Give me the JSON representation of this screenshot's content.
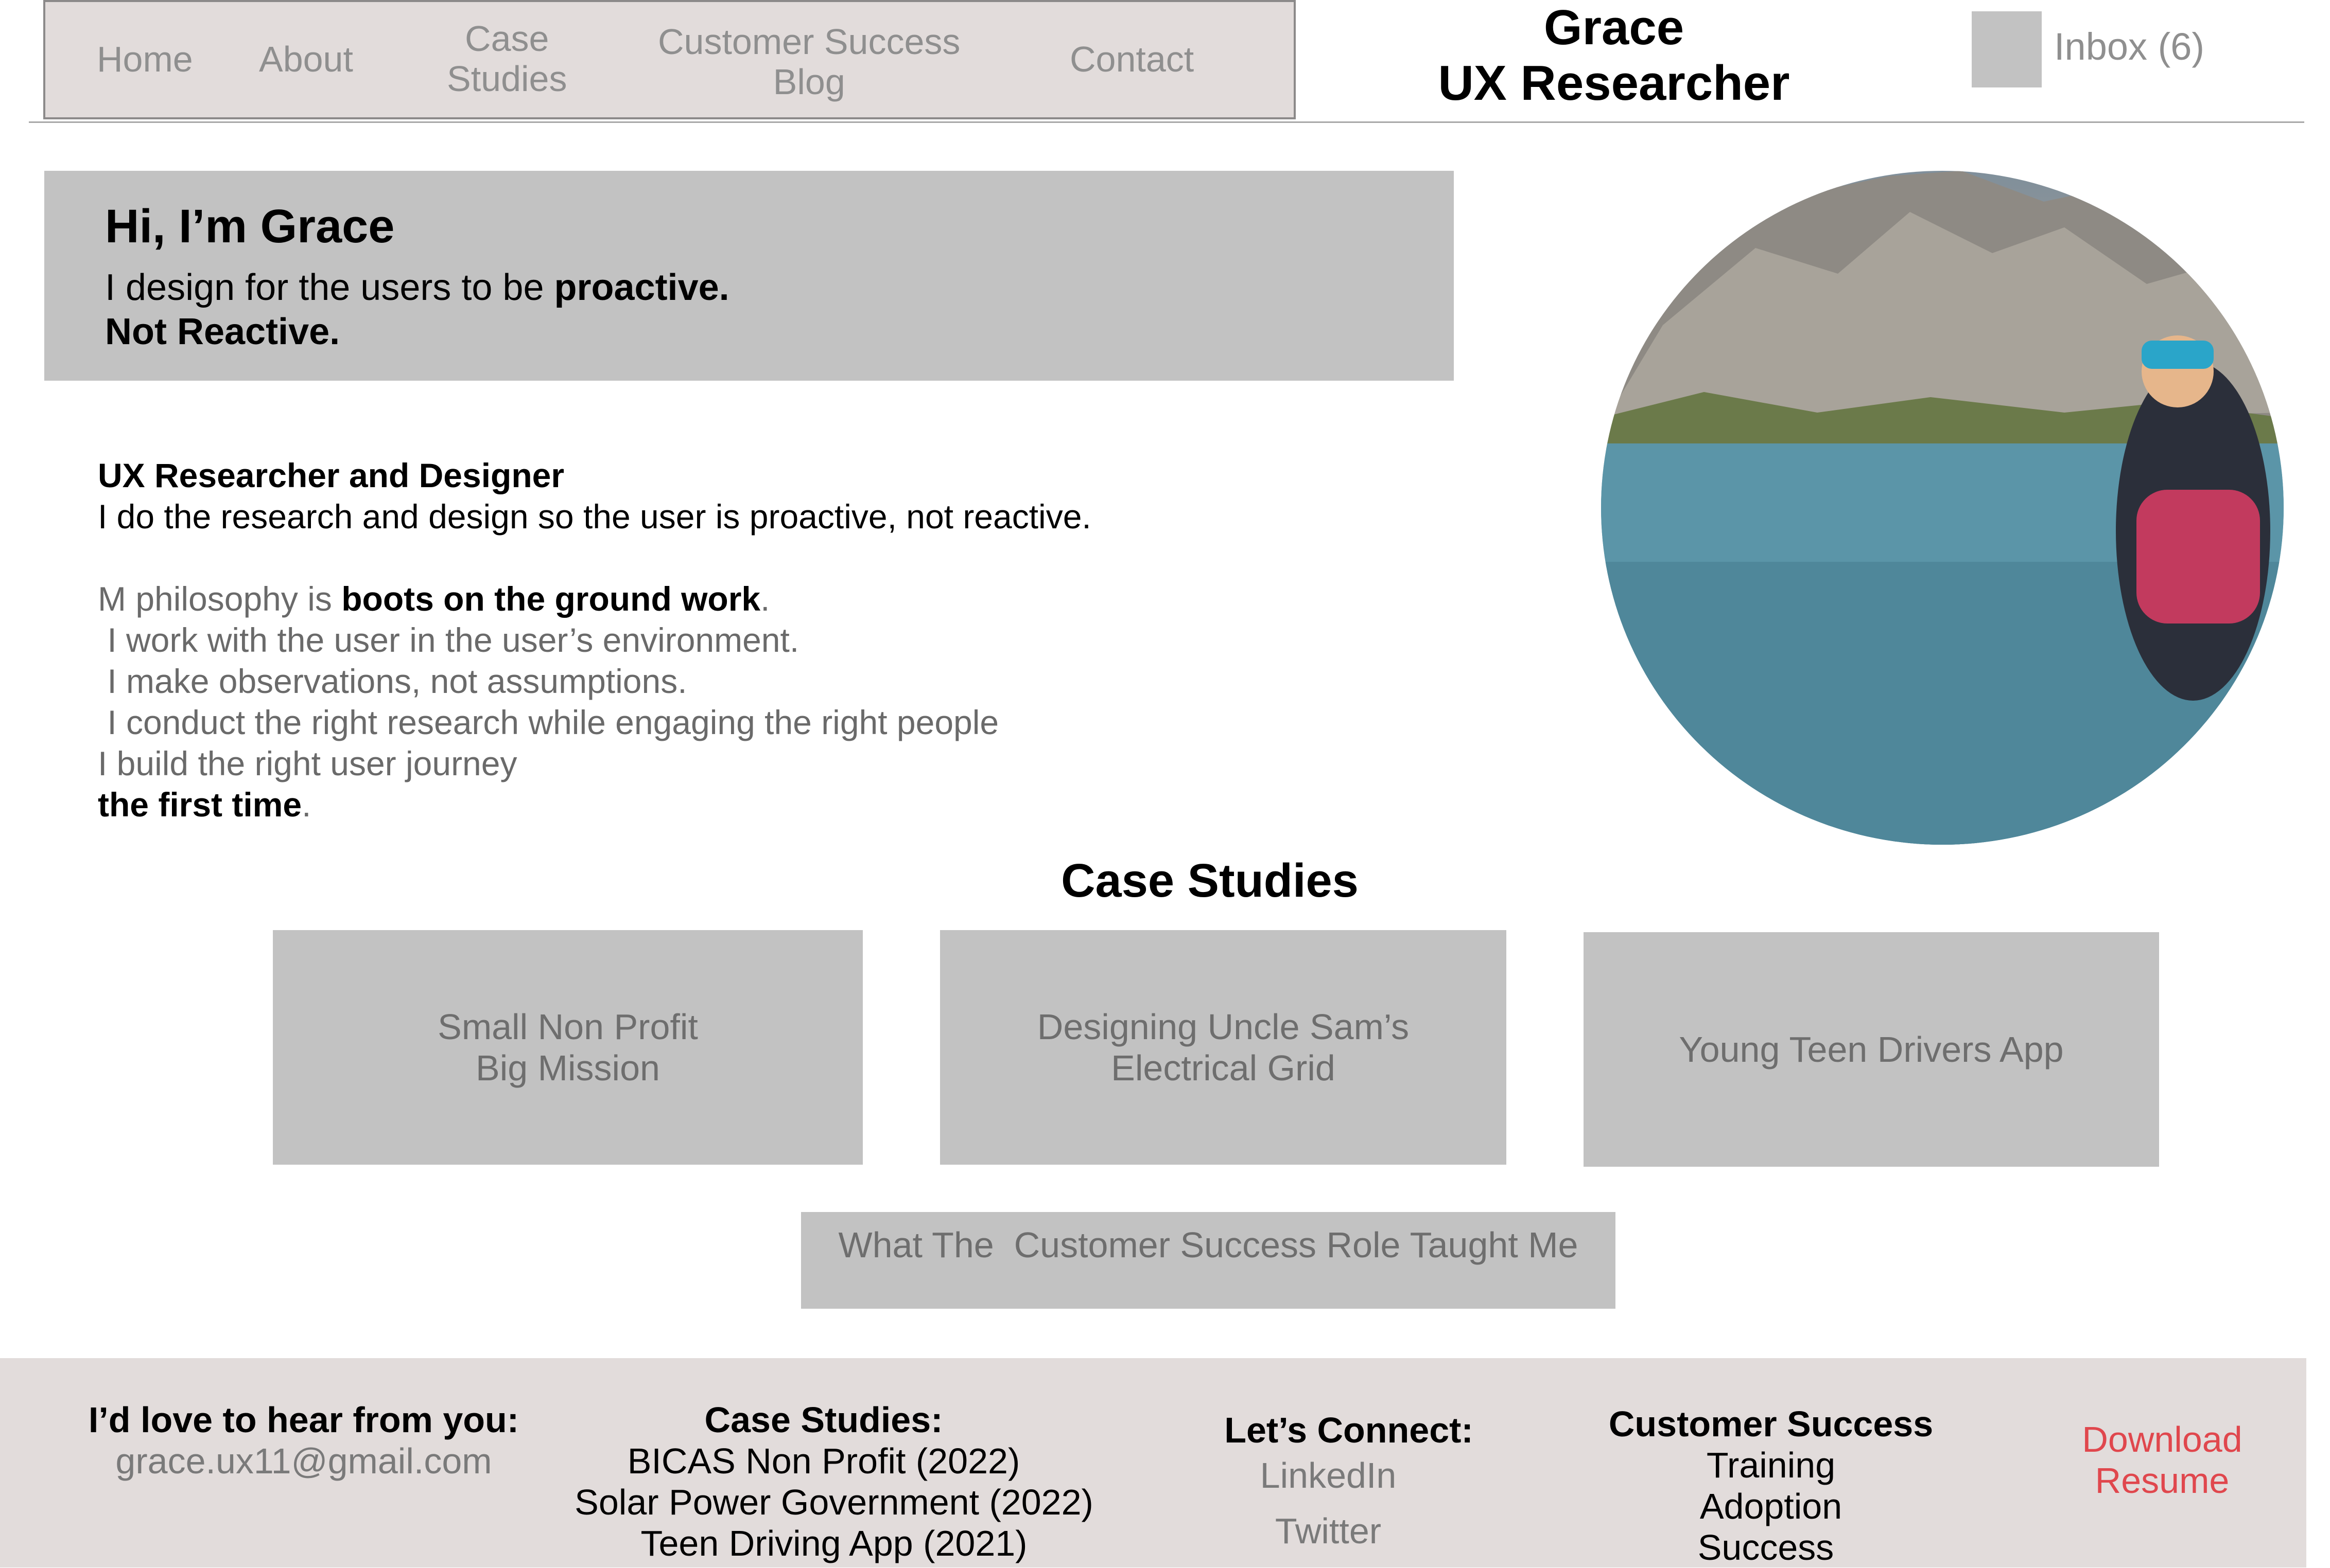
{
  "nav": {
    "items": [
      {
        "label": "Home"
      },
      {
        "label": "About"
      },
      {
        "label": "Case",
        "label2": "Studies"
      },
      {
        "label": "Customer Success",
        "label2": "Blog"
      },
      {
        "label": "Contact"
      }
    ]
  },
  "brand": {
    "line1": "Grace",
    "line2": "UX Researcher"
  },
  "inbox": {
    "label": "Inbox (6)"
  },
  "hero": {
    "title": "Hi, I’m Grace",
    "line1_pre": "I design for the users to be ",
    "line1_bold": "proactive.",
    "line2": "Not Reactive."
  },
  "bio": {
    "heading": "UX Researcher and Designer",
    "summary": "I do the research and design so the user is proactive, not reactive.",
    "philosophy_pre": "M philosophy is ",
    "philosophy_bold": "boots on the ground work",
    "philosophy_post": ".",
    "points": [
      " I work with the user in the user’s environment.",
      " I make observations, not assumptions.",
      " I conduct the right research while engaging the right people",
      "I build the right user journey"
    ],
    "closing_bold": "the first time",
    "closing_post": "."
  },
  "case_studies": {
    "title": "Case Studies",
    "cards": [
      {
        "line1": "Small Non Profit",
        "line2": "Big Mission"
      },
      {
        "line1": "Designing Uncle Sam’s",
        "line2": "Electrical Grid"
      },
      {
        "line1": "Young Teen Drivers App",
        "line2": ""
      },
      {
        "line1": "What The  Customer Success Role Taught Me",
        "line2": ""
      }
    ]
  },
  "footer": {
    "contact": {
      "heading": "I’d love to hear from you:",
      "email": "grace.ux11@gmail.com"
    },
    "case_studies": {
      "heading": "Case Studies:",
      "items": [
        "BICAS Non Profit (2022)",
        "Solar Power Government (2022)",
        "Teen Driving App (2021)"
      ]
    },
    "connect": {
      "heading": "Let’s Connect:",
      "links": [
        "LinkedIn",
        "Twitter"
      ]
    },
    "customer_success": {
      "heading": "Customer Success",
      "items": [
        "Training",
        "Adoption",
        "Success"
      ]
    },
    "resume": {
      "line1": "Download",
      "line2": "Resume",
      "color": "#e0474d"
    }
  },
  "colors": {
    "nav_bg": "#e2dcdb",
    "card_bg": "#c2c2c2",
    "muted_text": "#8f8f8f",
    "accent_red": "#e0474d"
  }
}
